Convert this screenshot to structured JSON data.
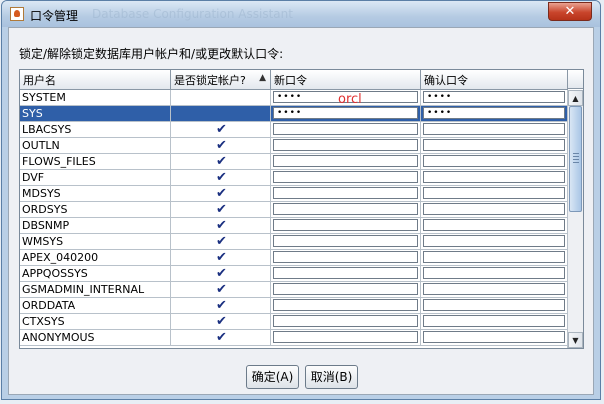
{
  "window": {
    "title": "口令管理",
    "ghost_title": "Database Configuration Assistant",
    "close_label": "✕"
  },
  "instruction": "锁定/解除锁定数据库用户帐户和/或更改默认口令:",
  "table": {
    "headers": [
      "用户名",
      "是否锁定帐户?",
      "新口令",
      "确认口令"
    ],
    "sort_indicator": "▲",
    "rows": [
      {
        "user": "SYSTEM",
        "locked": false,
        "new_pwd": "••••",
        "confirm_pwd": "••••",
        "selected": false
      },
      {
        "user": "SYS",
        "locked": false,
        "new_pwd": "••••",
        "confirm_pwd": "••••",
        "selected": true
      },
      {
        "user": "LBACSYS",
        "locked": true,
        "new_pwd": "",
        "confirm_pwd": "",
        "selected": false
      },
      {
        "user": "OUTLN",
        "locked": true,
        "new_pwd": "",
        "confirm_pwd": "",
        "selected": false
      },
      {
        "user": "FLOWS_FILES",
        "locked": true,
        "new_pwd": "",
        "confirm_pwd": "",
        "selected": false
      },
      {
        "user": "DVF",
        "locked": true,
        "new_pwd": "",
        "confirm_pwd": "",
        "selected": false
      },
      {
        "user": "MDSYS",
        "locked": true,
        "new_pwd": "",
        "confirm_pwd": "",
        "selected": false
      },
      {
        "user": "ORDSYS",
        "locked": true,
        "new_pwd": "",
        "confirm_pwd": "",
        "selected": false
      },
      {
        "user": "DBSNMP",
        "locked": true,
        "new_pwd": "",
        "confirm_pwd": "",
        "selected": false
      },
      {
        "user": "WMSYS",
        "locked": true,
        "new_pwd": "",
        "confirm_pwd": "",
        "selected": false
      },
      {
        "user": "APEX_040200",
        "locked": true,
        "new_pwd": "",
        "confirm_pwd": "",
        "selected": false
      },
      {
        "user": "APPQOSSYS",
        "locked": true,
        "new_pwd": "",
        "confirm_pwd": "",
        "selected": false
      },
      {
        "user": "GSMADMIN_INTERNAL",
        "locked": true,
        "new_pwd": "",
        "confirm_pwd": "",
        "selected": false
      },
      {
        "user": "ORDDATA",
        "locked": true,
        "new_pwd": "",
        "confirm_pwd": "",
        "selected": false
      },
      {
        "user": "CTXSYS",
        "locked": true,
        "new_pwd": "",
        "confirm_pwd": "",
        "selected": false
      },
      {
        "user": "ANONYMOUS",
        "locked": true,
        "new_pwd": "",
        "confirm_pwd": "",
        "selected": false
      }
    ]
  },
  "overlay_text": "orcl",
  "buttons": {
    "ok": "确定(A)",
    "cancel": "取消(B)"
  },
  "icons": {
    "check": "✔",
    "scroll_up": "▲",
    "scroll_down": "▼"
  },
  "colors": {
    "selection": "#2f5fa8",
    "check": "#1a2f80",
    "overlay": "#e03030"
  }
}
